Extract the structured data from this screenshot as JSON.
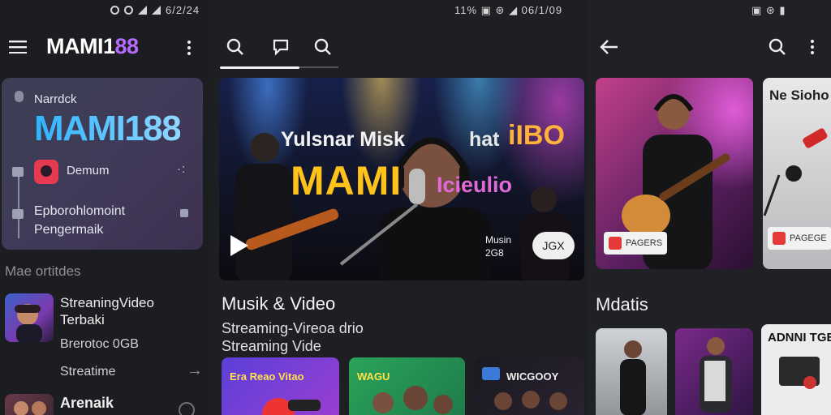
{
  "colors": {
    "accent": "#b569ff",
    "logo_blue": "#3bb8ff",
    "background": "#1c1d20"
  },
  "panel1": {
    "status": "6/2/24",
    "title_main": "MAMI1",
    "title_accent": "88",
    "card": {
      "label_top": "Narrdck",
      "logo": "MAMI188",
      "item1": "Demum",
      "item2_line1": "Epborohlomoint",
      "item2_line2": "Pengermaik"
    },
    "section_title": "Mae ortitdes",
    "list": [
      {
        "title": "StreaningVideo",
        "subtitle": "Terbaki",
        "line3": "Brerotoc 0GB",
        "line4": "Streatime"
      },
      {
        "title": "Arenaik"
      }
    ]
  },
  "panel2": {
    "status": "11% ▣ ⊛ ◢ 06/1/09",
    "hero": {
      "text1": "Yulsnar Misk",
      "text2": "hat",
      "text2b": "iIBO",
      "text3": "MAMI",
      "text4": "Icieulio",
      "caption_line1": "Musin",
      "caption_line2": "2G8",
      "button": "JGX"
    },
    "heading": "Musik & Video",
    "sub1": "Streaming-Vireoa drio",
    "sub2": "Streaming Vide",
    "minis": [
      {
        "label": "Era Reao Vitao"
      },
      {
        "label": "WAGU"
      },
      {
        "label": "WICGOOY"
      }
    ]
  },
  "panel3": {
    "status": "▣ ⊛ ▮",
    "card1_badge": "PAGERS",
    "card2_title": "Ne Sioho",
    "card2_badge": "PAGEGE",
    "heading": "Mdatis",
    "bottom_title": "ADNNI TGE"
  }
}
